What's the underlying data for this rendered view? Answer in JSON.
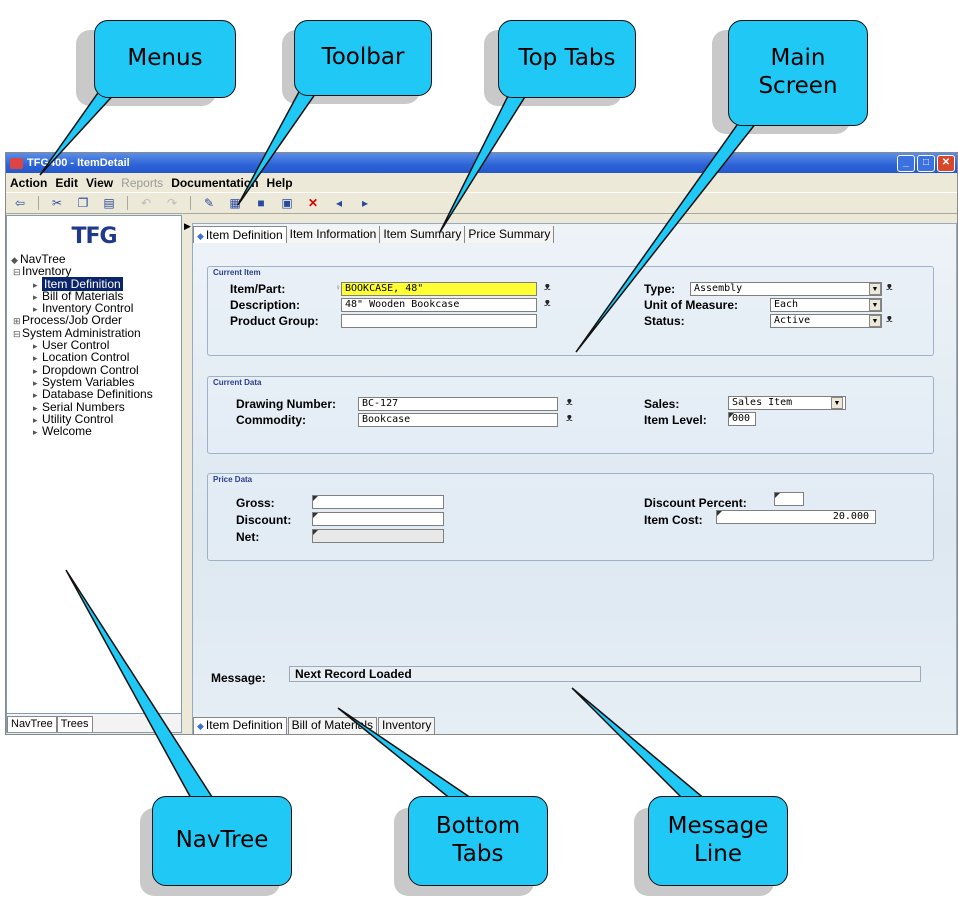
{
  "window": {
    "title": "TFG400 - ItemDetail",
    "buttons": [
      "_",
      "□",
      "✕"
    ]
  },
  "menu": [
    "Action",
    "Edit",
    "View",
    "Reports",
    "Documentation",
    "Help"
  ],
  "toolbar_icons": [
    "back-icon",
    "cut-icon",
    "copy-icon",
    "paste-icon",
    "undo-icon",
    "redo-icon",
    "edit-icon",
    "save-icon",
    "new-icon",
    "print-icon",
    "delete-icon",
    "prev-icon",
    "next-icon"
  ],
  "nav": {
    "logo": "TFG",
    "root": "NavTree",
    "items": [
      {
        "label": "Inventory",
        "level": 1
      },
      {
        "label": "Item Definition",
        "level": 2,
        "selected": true
      },
      {
        "label": "Bill of Materials",
        "level": 2
      },
      {
        "label": "Inventory Control",
        "level": 2
      },
      {
        "label": "Process/Job Order",
        "level": 1
      },
      {
        "label": "System Administration",
        "level": 1
      },
      {
        "label": "User Control",
        "level": 2
      },
      {
        "label": "Location Control",
        "level": 2
      },
      {
        "label": "Dropdown Control",
        "level": 2
      },
      {
        "label": "System Variables",
        "level": 2
      },
      {
        "label": "Database Definitions",
        "level": 2
      },
      {
        "label": "Serial Numbers",
        "level": 2
      },
      {
        "label": "Utility Control",
        "level": 2
      },
      {
        "label": "Welcome",
        "level": 2
      }
    ],
    "tabs": [
      "NavTree",
      "Trees"
    ]
  },
  "top_tabs": [
    "Item Definition",
    "Item Information",
    "Item Summary",
    "Price Summary"
  ],
  "current_item": {
    "title": "Current Item",
    "item_part_label": "Item/Part:",
    "item_part": "BOOKCASE, 48\"",
    "description_label": "Description:",
    "description": "48\" Wooden Bookcase",
    "product_group_label": "Product Group:",
    "product_group": "",
    "type_label": "Type:",
    "type": "Assembly",
    "uom_label": "Unit of Measure:",
    "uom": "Each",
    "status_label": "Status:",
    "status": "Active"
  },
  "current_data": {
    "title": "Current Data",
    "drawing_label": "Drawing Number:",
    "drawing": "BC-127",
    "commodity_label": "Commodity:",
    "commodity": "Bookcase",
    "sales_label": "Sales:",
    "sales": "Sales Item",
    "item_level_label": "Item Level:",
    "item_level": "000"
  },
  "price_data": {
    "title": "Price Data",
    "gross_label": "Gross:",
    "gross": "",
    "discount_label": "Discount:",
    "discount": "",
    "net_label": "Net:",
    "net": "",
    "discount_percent_label": "Discount Percent:",
    "discount_percent": "",
    "item_cost_label": "Item Cost:",
    "item_cost": "20.000"
  },
  "message": {
    "label": "Message:",
    "text": "Next Record Loaded"
  },
  "bottom_tabs": [
    "Item Definition",
    "Bill of Materials",
    "Inventory"
  ],
  "callouts": {
    "menus": "Menus",
    "toolbar": "Toolbar",
    "top_tabs": "Top Tabs",
    "main_screen": "Main\nScreen",
    "navtree": "NavTree",
    "bottom_tabs": "Bottom\nTabs",
    "message_line": "Message\nLine"
  },
  "colors": {
    "callout": "#1fc8f5",
    "title_bar": "#2d63d8",
    "highlight_field": "#ffff33",
    "selected_node": "#0a246a"
  }
}
